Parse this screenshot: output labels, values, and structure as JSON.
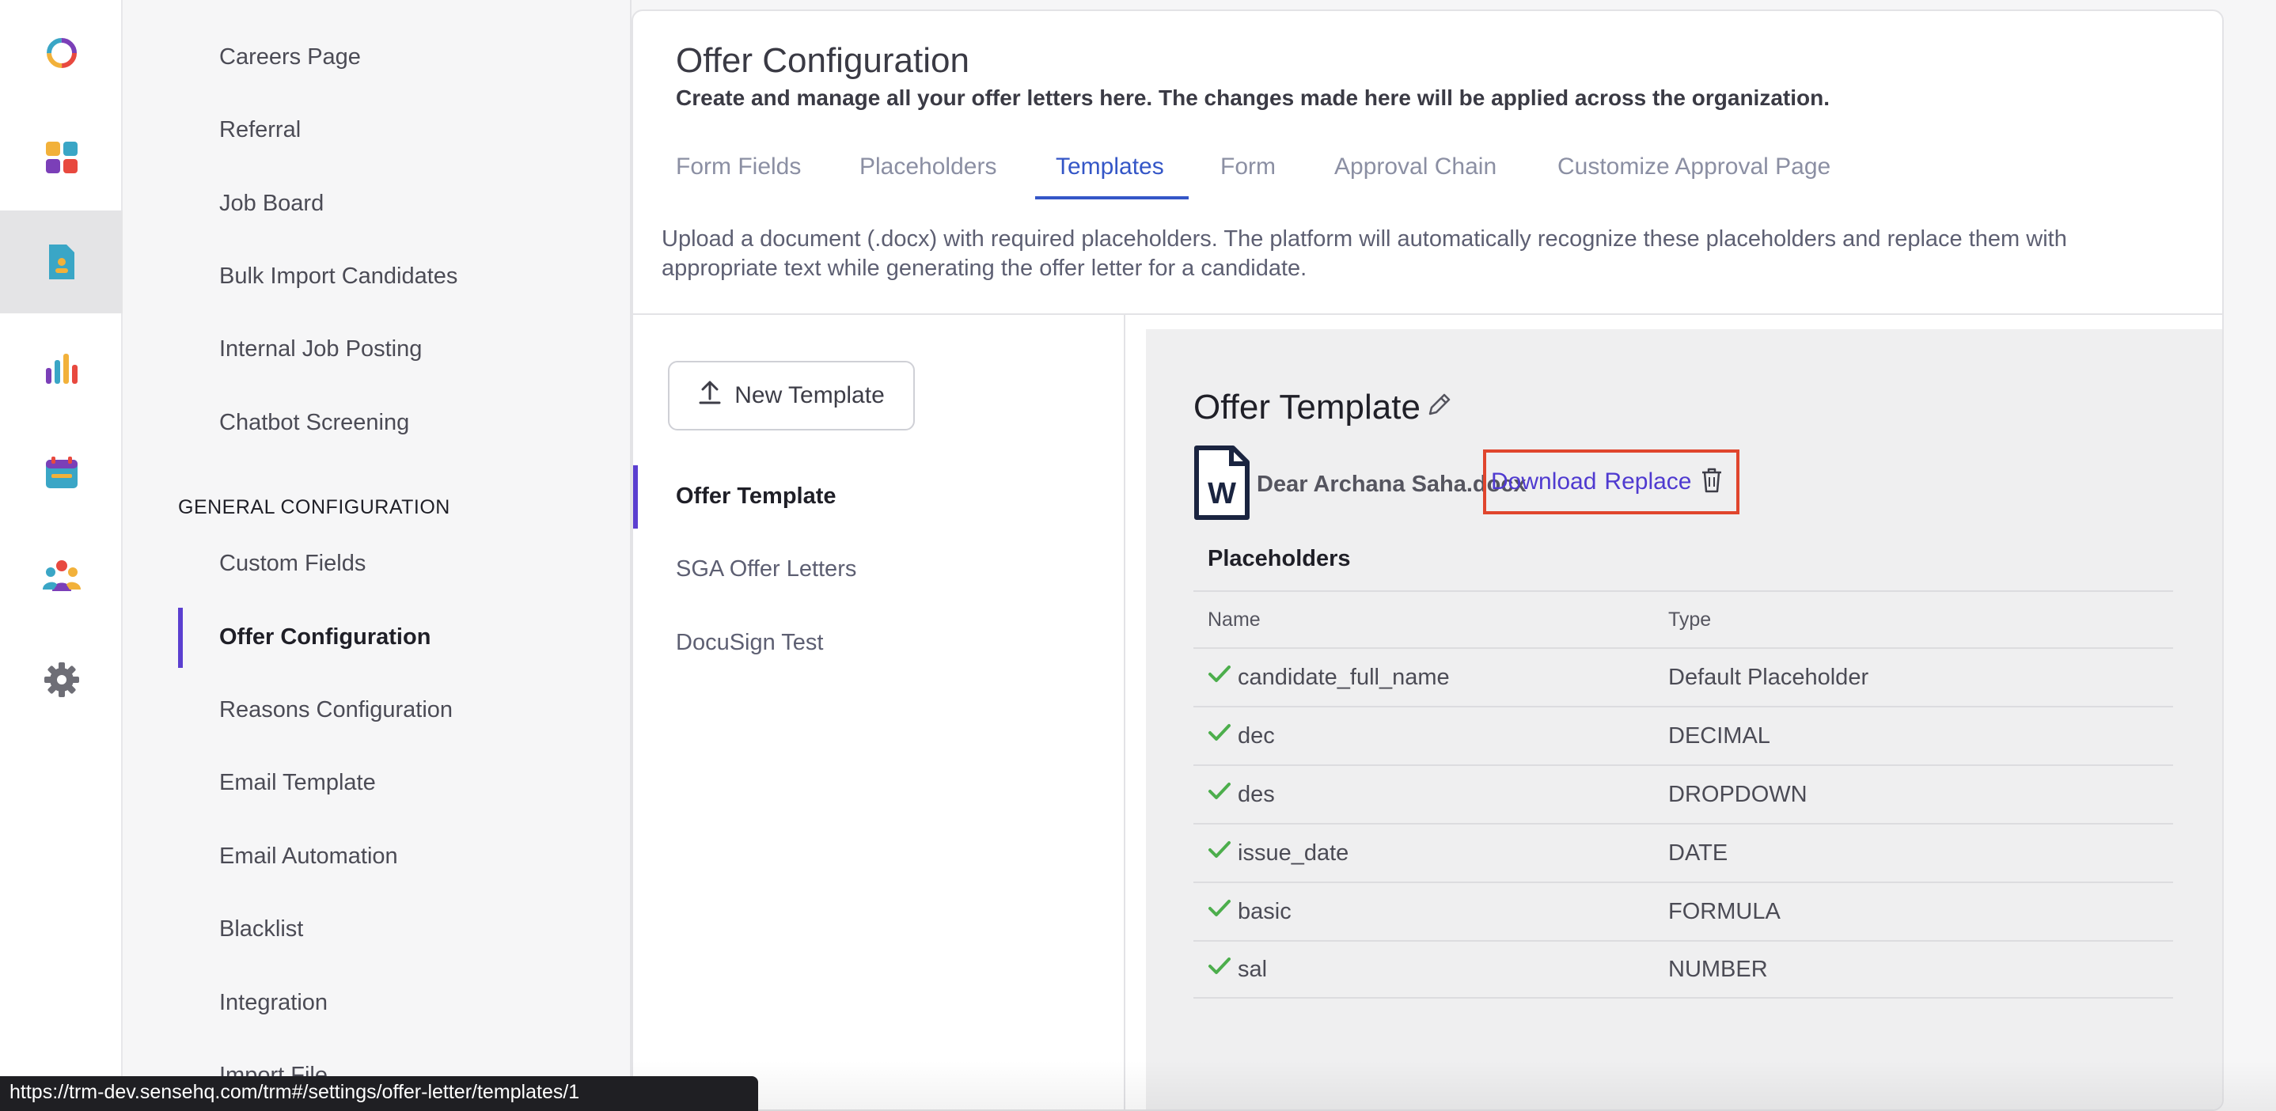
{
  "rail": {
    "icons": [
      "app-logo-icon",
      "dashboard-icon",
      "document-icon",
      "analytics-icon",
      "calendar-icon",
      "team-icon",
      "settings-icon"
    ]
  },
  "settings_nav": {
    "items_top": [
      "Careers Page",
      "Referral",
      "Job Board",
      "Bulk Import Candidates",
      "Internal Job Posting",
      "Chatbot Screening"
    ],
    "section_title": "GENERAL CONFIGURATION",
    "items_general": [
      "Custom Fields",
      "Offer Configuration",
      "Reasons Configuration",
      "Email Template",
      "Email Automation",
      "Blacklist",
      "Integration",
      "Import File"
    ],
    "active": "Offer Configuration"
  },
  "page": {
    "title": "Offer Configuration",
    "subtitle": "Create and manage all your offer letters here. The changes made here will be applied across the organization.",
    "tabs": [
      "Form Fields",
      "Placeholders",
      "Templates",
      "Form",
      "Approval Chain",
      "Customize Approval Page"
    ],
    "active_tab": "Templates",
    "description": "Upload a document (.docx) with required placeholders. The platform will automatically recognize these placeholders and replace them with appropriate text while generating the offer letter for a candidate."
  },
  "templates": {
    "new_button": "New Template",
    "items": [
      "Offer Template",
      "SGA Offer Letters",
      "DocuSign Test"
    ],
    "active": "Offer Template"
  },
  "detail": {
    "title": "Offer Template",
    "file_name": "Dear Archana Saha.docx",
    "download_label": "Download",
    "replace_label": "Replace",
    "placeholders_heading": "Placeholders",
    "columns": [
      "Name",
      "Type"
    ],
    "rows": [
      {
        "name": "candidate_full_name",
        "type": "Default Placeholder"
      },
      {
        "name": "dec",
        "type": "DECIMAL"
      },
      {
        "name": "des",
        "type": "DROPDOWN"
      },
      {
        "name": "issue_date",
        "type": "DATE"
      },
      {
        "name": "basic",
        "type": "FORMULA"
      },
      {
        "name": "sal",
        "type": "NUMBER"
      }
    ]
  },
  "status_url": "https://trm-dev.sensehq.com/trm#/settings/offer-letter/templates/1",
  "colors": {
    "accent": "#5b3fd0",
    "tab_active": "#3456c7",
    "check": "#4cae4c",
    "highlight_box": "#e0452d"
  }
}
